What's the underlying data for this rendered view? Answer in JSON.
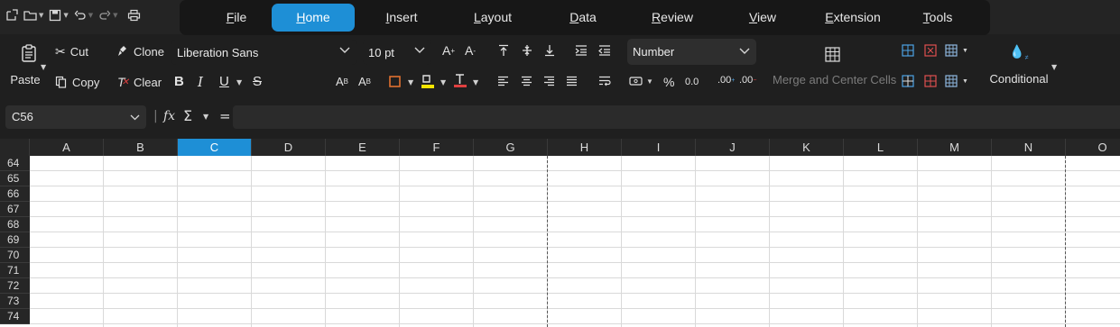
{
  "menu": {
    "tabs": [
      {
        "label": "File",
        "accel": "F"
      },
      {
        "label": "Home",
        "accel": "H"
      },
      {
        "label": "Insert",
        "accel": "I"
      },
      {
        "label": "Layout",
        "accel": "L"
      },
      {
        "label": "Data",
        "accel": "D"
      },
      {
        "label": "Review",
        "accel": "R"
      },
      {
        "label": "View",
        "accel": "V"
      },
      {
        "label": "Extension",
        "accel": "E"
      },
      {
        "label": "Tools",
        "accel": "T"
      }
    ],
    "active_tab": "Home"
  },
  "toolbar": {
    "paste_label": "Paste",
    "cut_label": "Cut",
    "clone_label": "Clone",
    "copy_label": "Copy",
    "clear_label": "Clear",
    "font_name": "Liberation Sans",
    "font_size": "10 pt",
    "number_format": "Number",
    "percent_symbol": "%",
    "decimal_symbol": "0.0",
    "add_decimal_symbol": ".00",
    "del_decimal_symbol": ".00",
    "merge_label": "Merge and Center Cells",
    "conditional_label": "Conditional",
    "highlight_color": "#f5e400",
    "font_color": "#e04040"
  },
  "formula_bar": {
    "cell_ref": "C56",
    "fx_symbol": "fx",
    "sum_symbol": "Σ",
    "equals_symbol": "=",
    "content": ""
  },
  "sheet": {
    "columns": [
      "A",
      "B",
      "C",
      "D",
      "E",
      "F",
      "G",
      "H",
      "I",
      "J",
      "K",
      "L",
      "M",
      "N",
      "O"
    ],
    "selected_column": "C",
    "rows": [
      "64",
      "65",
      "66",
      "67",
      "68",
      "69",
      "70",
      "71",
      "72",
      "73",
      "74"
    ],
    "accent_color": "#1e8fd6"
  }
}
